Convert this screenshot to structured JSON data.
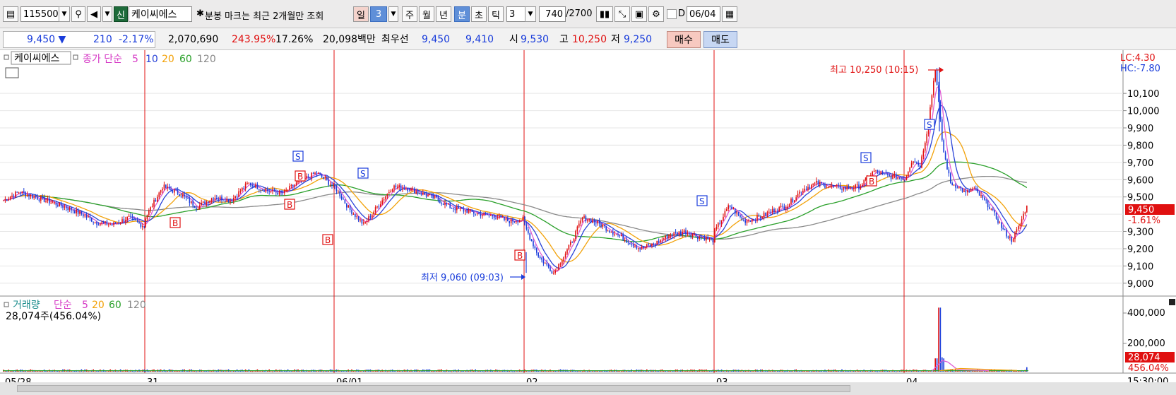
{
  "toolbar": {
    "code": "115500",
    "tag": "신",
    "stock_name": "케이씨에스",
    "note": "분봉 마크는 최근 2개월만 조회",
    "period_day": "일",
    "period_day_num": "3",
    "period_week": "주",
    "period_month": "월",
    "period_year": "년",
    "period_minute": "분",
    "period_second": "초",
    "period_tick": "틱",
    "interval": "3",
    "count": "740",
    "total": "/2700",
    "date_label": "D",
    "date": "06/04"
  },
  "quote": {
    "price": "9,450",
    "change": "210",
    "change_pct": "-2.17%",
    "volume": "2,070,690",
    "vol_ratio": "243.95%",
    "turnover": "17.26%",
    "amount": "20,098백만",
    "best_label": "최우선",
    "best_ask": "9,450",
    "best_bid": "9,410",
    "open_label": "시",
    "open": "9,530",
    "high_label": "고",
    "high": "10,250",
    "low_label": "저",
    "low": "9,250",
    "buy_label": "매수",
    "sell_label": "매도"
  },
  "price_panel": {
    "legend_name": "케이씨에스",
    "legend_type": "종가 단순",
    "ma": [
      "5",
      "10",
      "20",
      "60",
      "120"
    ],
    "high_note": "최고 10,250 (10:15)",
    "low_note": "최저 9,060 (09:03)",
    "lc": "LC:4.30",
    "hc": "HC:-7.80",
    "current_price": "9,450",
    "current_pct": "-1.61%",
    "y_labels": [
      "10,100",
      "10,000",
      "9,900",
      "9,800",
      "9,700",
      "9,600",
      "9,500",
      "9,300",
      "9,200",
      "9,100",
      "9,000"
    ],
    "signal_s": "S",
    "signal_b": "B"
  },
  "volume_panel": {
    "legend_name": "거래량",
    "legend_type": "단순",
    "ma": [
      "5",
      "20",
      "60",
      "120"
    ],
    "info": "28,074주(456.04%)",
    "y_labels": [
      "400,000",
      "200,000"
    ],
    "current_vol": "28,074",
    "current_pct": "456.04%"
  },
  "x_axis": {
    "labels": [
      "05/28",
      "31",
      "06/01",
      "02",
      "03",
      "04"
    ],
    "time": "15:30:00"
  },
  "colors": {
    "up": "#e01010",
    "down": "#1a3ddb",
    "ma5": "#e05bd4",
    "ma10": "#2a44d8",
    "ma20": "#f2a20a",
    "ma60": "#2aa02a",
    "ma120": "#8a8a8a"
  },
  "chart_data": {
    "type": "candlestick",
    "title": "",
    "y_range": [
      9000,
      10250
    ],
    "high": 10250,
    "low": 9060,
    "last": 9450,
    "sessions": [
      {
        "label": "05/28",
        "path": [
          9480,
          9530,
          9500,
          9470,
          9440,
          9400,
          9350,
          9340,
          9380,
          9330
        ]
      },
      {
        "label": "31",
        "path": [
          9380,
          9560,
          9520,
          9440,
          9500,
          9480,
          9580,
          9540,
          9520,
          9590,
          9640,
          9560
        ]
      },
      {
        "label": "06/01",
        "path": [
          9560,
          9430,
          9340,
          9450,
          9560,
          9550,
          9520,
          9490,
          9440,
          9420,
          9400,
          9390,
          9360,
          9370
        ]
      },
      {
        "label": "02",
        "path": [
          9330,
          9150,
          9060,
          9200,
          9380,
          9350,
          9300,
          9250,
          9200,
          9230,
          9280,
          9300,
          9270,
          9250
        ]
      },
      {
        "label": "03",
        "path": [
          9300,
          9450,
          9360,
          9380,
          9420,
          9450,
          9540,
          9580,
          9560,
          9550,
          9560,
          9650,
          9620,
          9610
        ]
      },
      {
        "label": "04",
        "path": [
          9600,
          9720,
          9680,
          9900,
          10250,
          9780,
          9580,
          9560,
          9520,
          9550,
          9500,
          9450,
          9380,
          9300,
          9250,
          9330,
          9450
        ]
      }
    ],
    "volume_peak": 400000,
    "volume_last": 28074
  }
}
